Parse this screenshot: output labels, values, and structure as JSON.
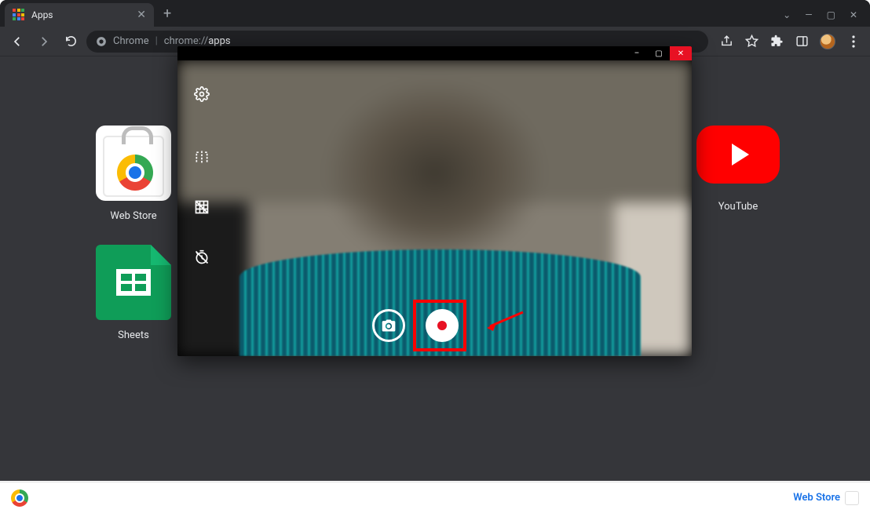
{
  "tab": {
    "title": "Apps"
  },
  "omnibox": {
    "scheme_label": "Chrome",
    "path_prefix": "chrome://",
    "path_bold": "apps"
  },
  "apps": {
    "webstore": {
      "label": "Web Store"
    },
    "sheets": {
      "label": "Sheets"
    },
    "youtube": {
      "label": "YouTube"
    }
  },
  "camera": {
    "controls": {
      "minimize": "–",
      "maximize": "▢",
      "close": "✕"
    }
  },
  "footer": {
    "webstore_label": "Web Store"
  }
}
